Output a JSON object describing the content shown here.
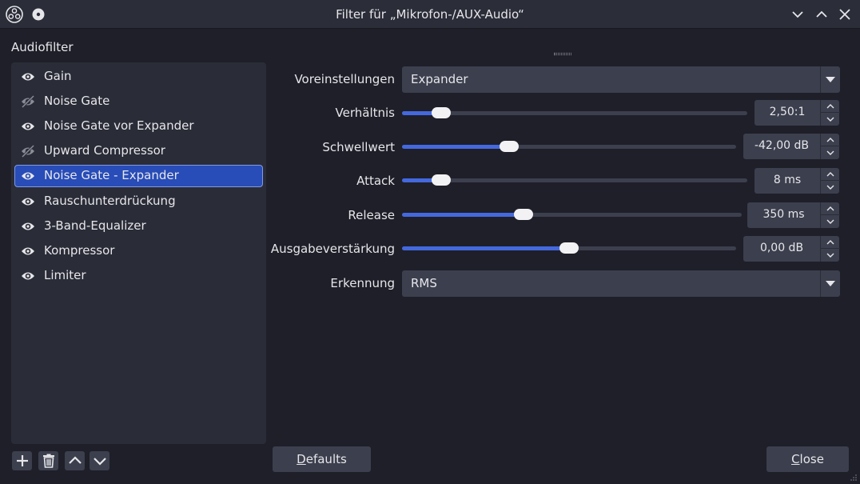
{
  "window": {
    "title": "Filter für „Mikrofon-/AUX-Audio“"
  },
  "sidebar": {
    "title": "Audiofilter",
    "items": [
      {
        "label": "Gain",
        "visible": true
      },
      {
        "label": "Noise Gate",
        "visible": false
      },
      {
        "label": "Noise Gate vor Expander",
        "visible": true
      },
      {
        "label": "Upward Compressor",
        "visible": false
      },
      {
        "label": "Noise Gate - Expander",
        "visible": true,
        "selected": true
      },
      {
        "label": "Rauschunterdrückung",
        "visible": true
      },
      {
        "label": "3-Band-Equalizer",
        "visible": true
      },
      {
        "label": "Kompressor",
        "visible": true
      },
      {
        "label": "Limiter",
        "visible": true
      }
    ],
    "toolbar_icons": [
      "add-icon",
      "trash-icon",
      "move-up-icon",
      "move-down-icon"
    ]
  },
  "properties": {
    "preset": {
      "label": "Voreinstellungen",
      "value": "Expander"
    },
    "ratio": {
      "label": "Verhältnis",
      "value": "2,50:1",
      "level": 0.09
    },
    "threshold": {
      "label": "Schwellwert",
      "value": "-42,00 dB",
      "level": 0.31
    },
    "attack": {
      "label": "Attack",
      "value": "8 ms",
      "level": 0.09
    },
    "release": {
      "label": "Release",
      "value": "350 ms",
      "level": 0.35
    },
    "output_gain": {
      "label": "Ausgabeverstärkung",
      "value": "0,00 dB",
      "level": 0.5
    },
    "detection": {
      "label": "Erkennung",
      "value": "RMS"
    }
  },
  "buttons": {
    "defaults_first": "D",
    "defaults_rest": "efaults",
    "close_first": "C",
    "close_rest": "lose"
  },
  "colors": {
    "accent": "#4468de",
    "selection": "#284cb8",
    "background": "#1e1f28",
    "panel": "#2a2c37",
    "control": "#3c3f4d"
  }
}
